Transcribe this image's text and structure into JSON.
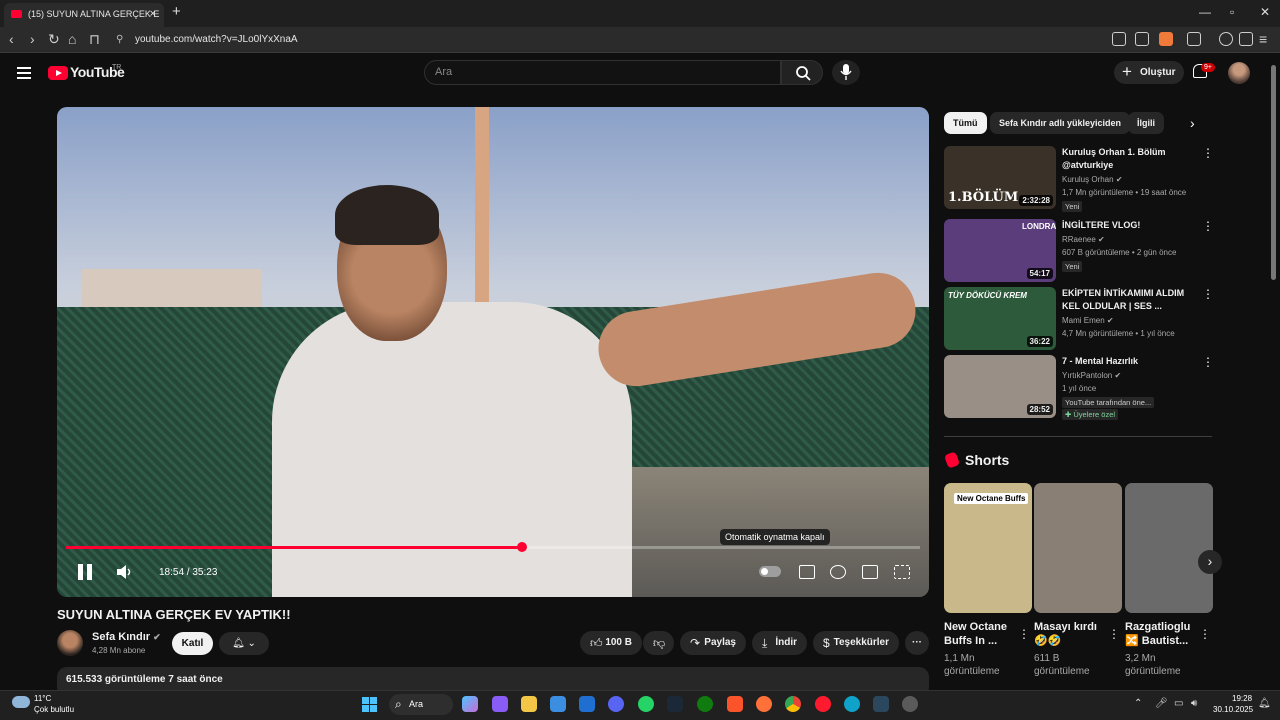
{
  "browser": {
    "tab_title": "(15) SUYUN ALTINA GERÇEK E",
    "tab_close": "×",
    "new_tab": "+",
    "url": "youtube.com/watch?v=JLo0lYxXnaA"
  },
  "header": {
    "logo_text": "YouTube",
    "country_code": "TR",
    "search_placeholder": "Ara",
    "create_label": "Oluştur",
    "notifications_count": "9+"
  },
  "player": {
    "time": "18:54 / 35:23",
    "progress_fraction": 0.534,
    "autoplay_tooltip": "Otomatik oynatma kapalı"
  },
  "video": {
    "title": "SUYUN ALTINA GERÇEK EV YAPTIK!!",
    "channel_name": "Sefa Kındır",
    "channel_subs": "4,28 Mn abone",
    "join_label": "Katıl",
    "likes": "100 B",
    "share_label": "Paylaş",
    "download_label": "İndir",
    "thanks_label": "Teşekkürler",
    "views_line": "615.533 görüntüleme  7 saat önce"
  },
  "sidebar": {
    "chips": [
      "Tümü",
      "Sefa Kındır adlı yükleyiciden",
      "İlgili"
    ],
    "recommendations": [
      {
        "title": "Kuruluş Orhan 1. Bölüm @atvturkiye",
        "channel": "Kuruluş Orhan",
        "meta": "1,7 Mn görüntüleme • 19 saat önce",
        "tags": [
          "Yeni"
        ],
        "duration": "2:32:28",
        "thumb_text": "1.BÖLÜM",
        "color": "#3a3128"
      },
      {
        "title": "İNGİLTERE VLOG!",
        "channel": "RRaenee",
        "meta": "607 B görüntüleme • 2 gün önce",
        "tags": [
          "Yeni"
        ],
        "duration": "54:17",
        "thumb_text": "LONDRA",
        "color": "#5a3d7a"
      },
      {
        "title": "EKİPTEN İNTİKAMIMI ALDIM KEL OLDULAR | SES ...",
        "channel": "Mami Emen",
        "meta": "4,7 Mn görüntüleme • 1 yıl önce",
        "tags": [],
        "duration": "36:22",
        "thumb_text": "TÜY DÖKÜCÜ KREM",
        "color": "#2d5a3a"
      },
      {
        "title": "7 - Mental Hazırlık",
        "channel": "YırtıkPantolon",
        "meta": "1 yıl önce",
        "tags": [
          "YouTube tarafından öne...",
          "Üyelere özel"
        ],
        "duration": "28:52",
        "thumb_text": "",
        "color": "#9a8f86"
      }
    ],
    "shorts_title": "Shorts",
    "shorts": [
      {
        "title": "New Octane Buffs In ...",
        "views": "1,1 Mn görüntüleme",
        "thumb_text": "New Octane Buffs",
        "color": "#c9b98a"
      },
      {
        "title": "Masayı kırdı 🤣🤣",
        "views": "611 B görüntüleme",
        "thumb_text": "",
        "color": "#8a7f74"
      },
      {
        "title": "Razgatlioglu 🔀 Bautist...",
        "views": "3,2 Mn görüntüleme",
        "thumb_text": "",
        "color": "#6a6a6a"
      }
    ]
  },
  "taskbar": {
    "temperature": "11°C",
    "weather": "Çok bulutlu",
    "search_label": "Ara",
    "time": "19:28",
    "date": "30.10.2025"
  },
  "colors": {
    "accent": "#ff0033",
    "background": "#0f0f0f",
    "chip": "#272727"
  }
}
